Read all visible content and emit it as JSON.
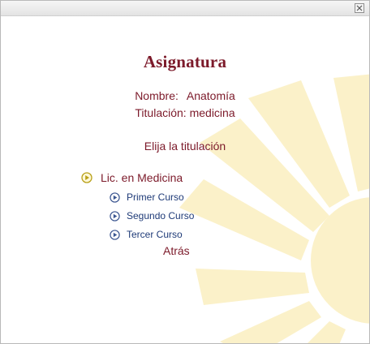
{
  "window": {
    "close_icon": "close-icon"
  },
  "content": {
    "title": "Asignatura",
    "nombre_label": "Nombre:",
    "nombre_value": "Anatomía",
    "titulacion_label": "Titulación:",
    "titulacion_value": "medicina",
    "prompt": "Elija la titulación",
    "program": {
      "label": "Lic. en Medicina",
      "icon": "play-circle-icon"
    },
    "courses": [
      {
        "label": "Primer Curso",
        "icon": "play-circle-icon"
      },
      {
        "label": "Segundo Curso",
        "icon": "play-circle-icon"
      },
      {
        "label": "Tercer Curso",
        "icon": "play-circle-icon"
      }
    ],
    "back_label": "Atrás"
  },
  "colors": {
    "title": "#7c1a2a",
    "course_link": "#1f3b78",
    "program_icon": "#b8a018",
    "watermark": "#fbf1c9"
  }
}
